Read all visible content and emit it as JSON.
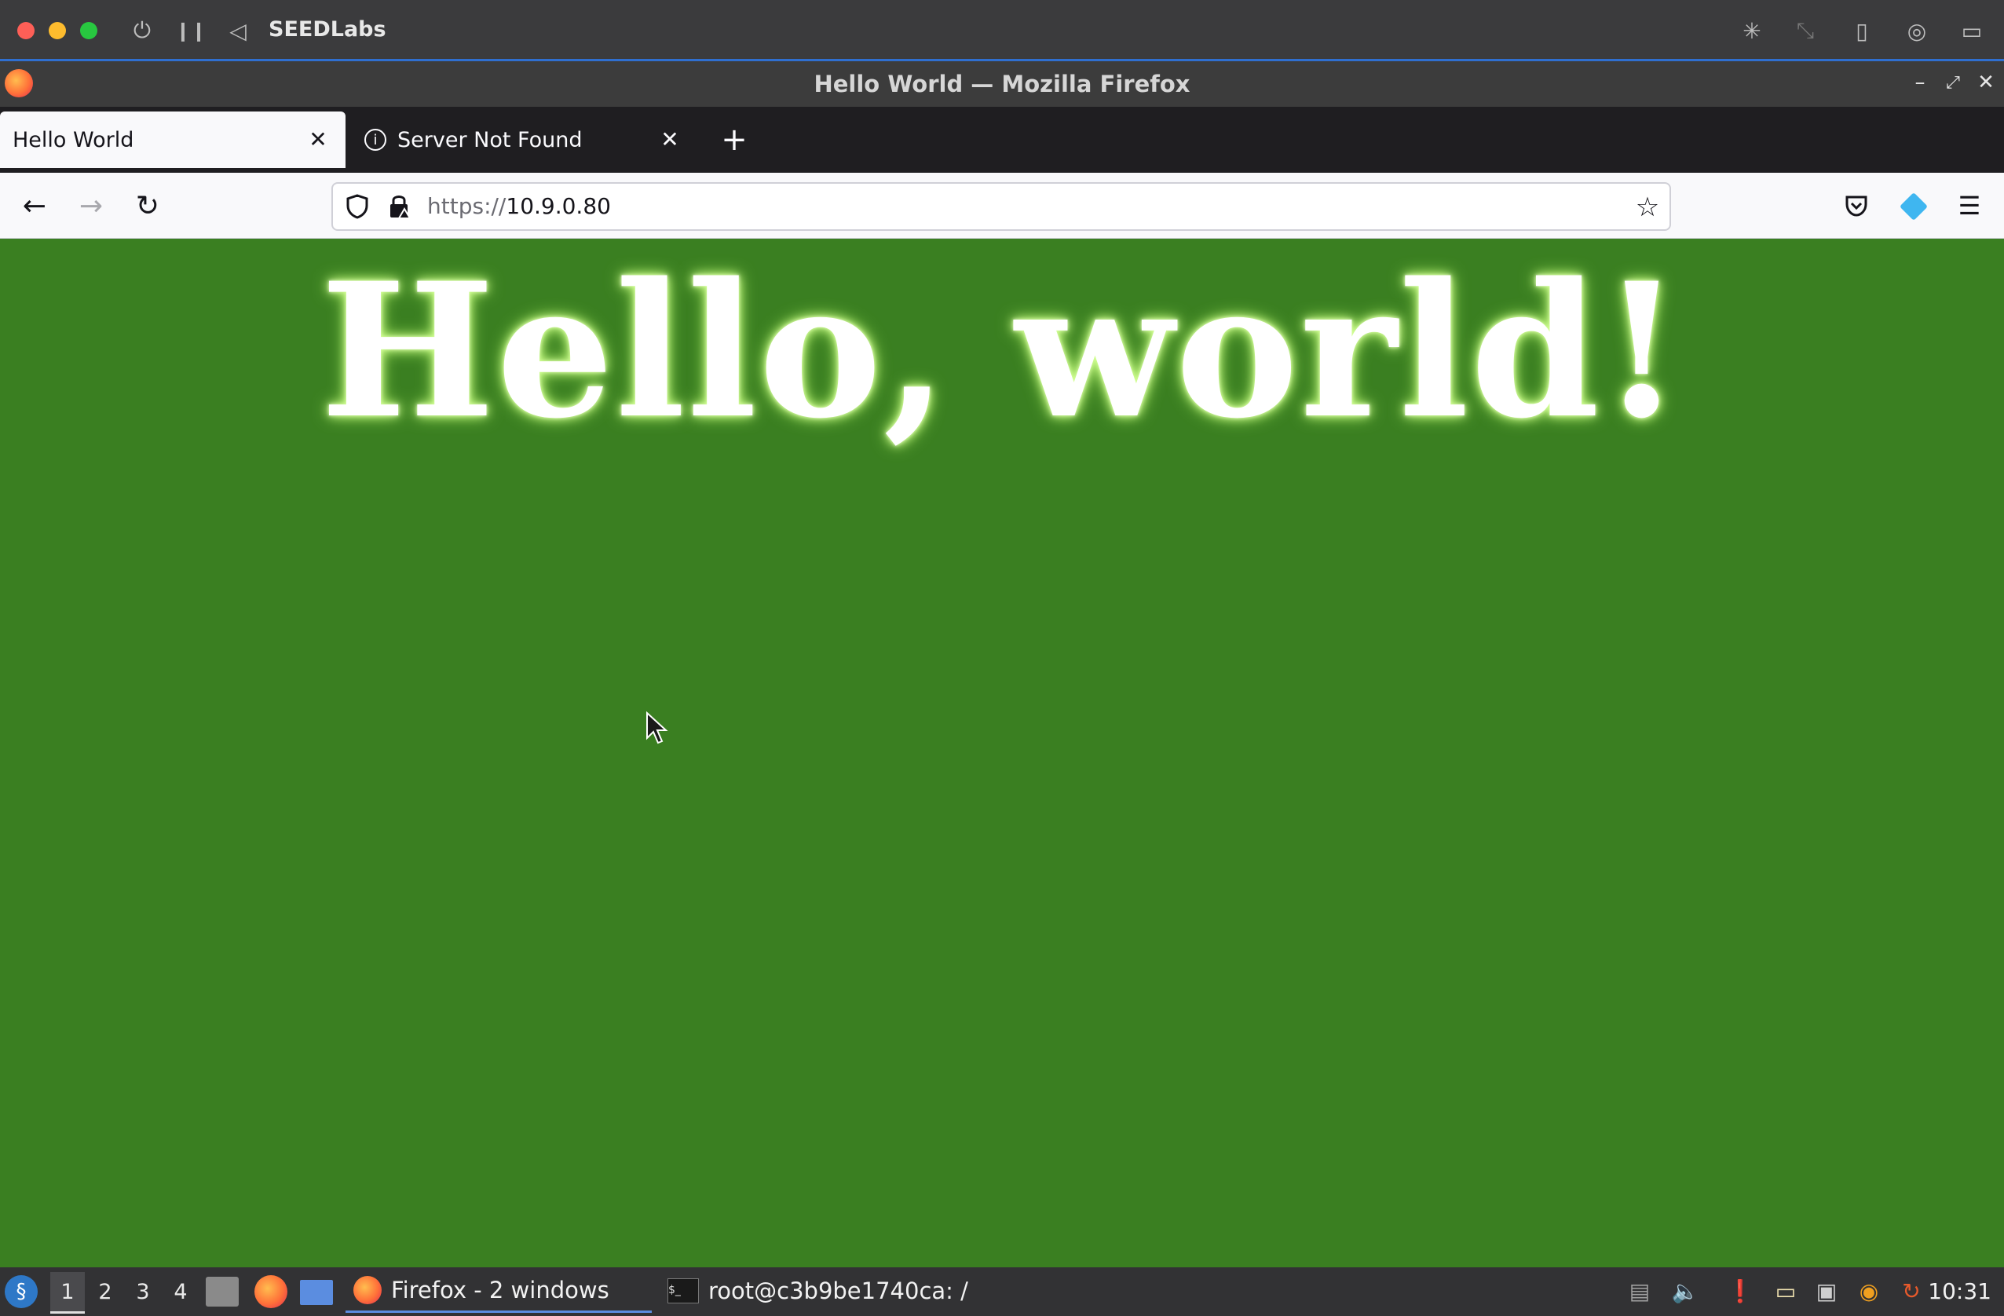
{
  "vm": {
    "title": "SEEDLabs",
    "icons": [
      "power-icon",
      "pause-icon",
      "back-icon",
      "brightness-icon",
      "resize-icon",
      "usb-icon",
      "camera-icon",
      "folder-icon"
    ]
  },
  "window": {
    "title": "Hello World — Mozilla Firefox"
  },
  "tabs": [
    {
      "label": "Hello World",
      "active": true
    },
    {
      "label": "Server Not Found",
      "active": false
    }
  ],
  "navbar": {
    "url_scheme": "https://",
    "url_host": "10.9.0.80"
  },
  "page": {
    "headline": "Hello, world!",
    "background": "#3a7f21"
  },
  "taskbar": {
    "workspaces": [
      "1",
      "2",
      "3",
      "4"
    ],
    "tasks": [
      {
        "label": "Firefox - 2 windows"
      },
      {
        "label": "root@c3b9be1740ca: /"
      }
    ],
    "clock": "10:31"
  }
}
